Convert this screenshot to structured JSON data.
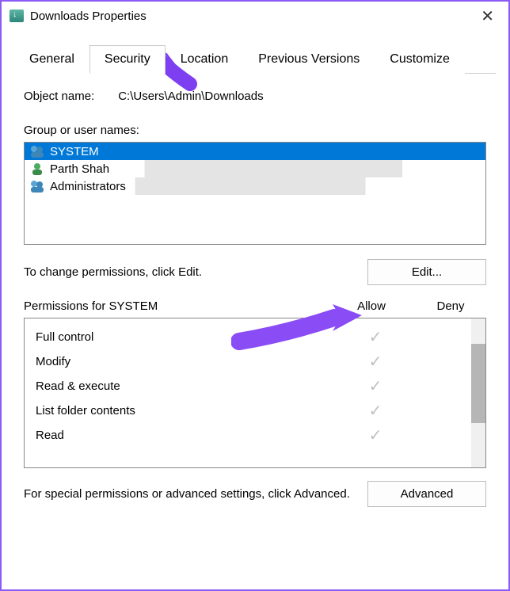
{
  "titlebar": {
    "title": "Downloads Properties"
  },
  "tabs": {
    "items": [
      {
        "label": "General"
      },
      {
        "label": "Security"
      },
      {
        "label": "Location"
      },
      {
        "label": "Previous Versions"
      },
      {
        "label": "Customize"
      }
    ],
    "active_index": 1
  },
  "security": {
    "object_label": "Object name:",
    "object_value": "C:\\Users\\Admin\\Downloads",
    "group_label": "Group or user names:",
    "users": [
      {
        "name": "SYSTEM",
        "icon": "group",
        "selected": true
      },
      {
        "name": "Parth Shah",
        "icon": "single",
        "selected": false
      },
      {
        "name": "Administrators",
        "icon": "group",
        "selected": false
      }
    ],
    "edit_text": "To change permissions, click Edit.",
    "edit_button": "Edit...",
    "perm_header": "Permissions for SYSTEM",
    "col_allow": "Allow",
    "col_deny": "Deny",
    "permissions": [
      {
        "name": "Full control",
        "allow": true,
        "deny": false
      },
      {
        "name": "Modify",
        "allow": true,
        "deny": false
      },
      {
        "name": "Read & execute",
        "allow": true,
        "deny": false
      },
      {
        "name": "List folder contents",
        "allow": true,
        "deny": false
      },
      {
        "name": "Read",
        "allow": true,
        "deny": false
      }
    ],
    "advanced_text": "For special permissions or advanced settings, click Advanced.",
    "advanced_button": "Advanced"
  }
}
